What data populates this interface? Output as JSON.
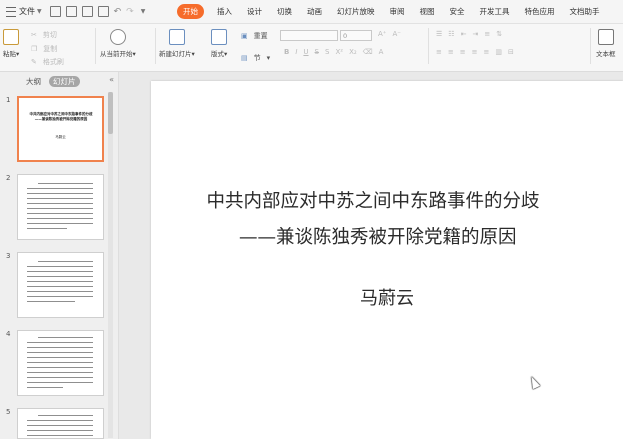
{
  "menubar": {
    "file_label": "文件",
    "tabs": [
      "开始",
      "插入",
      "设计",
      "切换",
      "动画",
      "幻灯片放映",
      "审阅",
      "视图",
      "安全",
      "开发工具",
      "特色应用",
      "文档助手"
    ],
    "active_tab": "开始"
  },
  "ribbon": {
    "paste": "粘贴",
    "cut": "剪切",
    "copy": "复制",
    "format_painter": "格式刷",
    "from_current": "从当前开始",
    "new_slide": "新建幻灯片",
    "layout": "版式",
    "reset": "重置",
    "section": "节",
    "font_size": "0",
    "textbox": "文本框"
  },
  "panel": {
    "tab_outline": "大纲",
    "tab_slides": "幻灯片",
    "slide_numbers": [
      "1",
      "2",
      "3",
      "4",
      "5"
    ],
    "slide1_title": "中共内部应对中苏之间中东路事件的分歧——兼谈陈独秀被开除党籍的原因",
    "slide1_author": "马蔚云"
  },
  "slide": {
    "title_line1": "中共内部应对中苏之间中东路事件的分歧",
    "title_line2": "——兼谈陈独秀被开除党籍的原因",
    "author": "马蔚云"
  }
}
